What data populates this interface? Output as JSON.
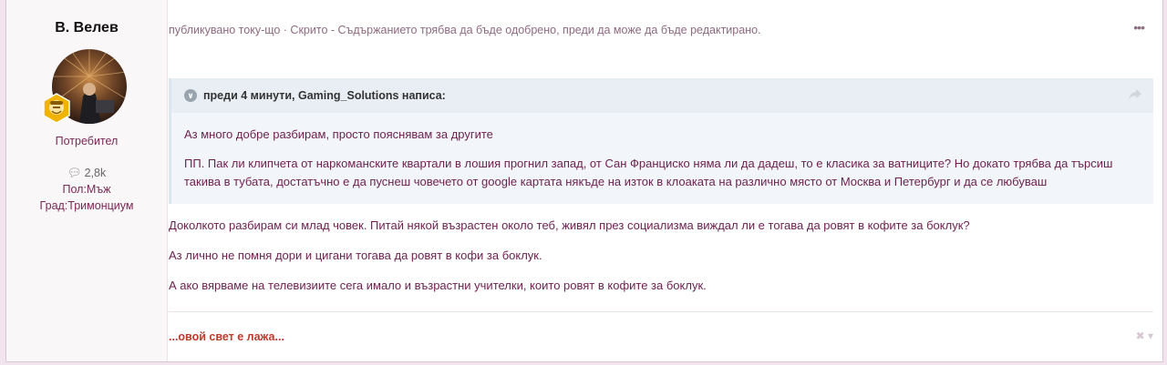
{
  "author": {
    "name": "В. Велев",
    "group": "Потребител",
    "posts": "2,8k",
    "fields": [
      "Пол:Мъж",
      "Град:Тримонциум"
    ]
  },
  "post": {
    "meta": "публикувано току-що · Скрито - Съдържанието трябва да бъде одобрено, преди да може да бъде редактирано.",
    "more_icon": "•••",
    "quote": {
      "header": "преди 4 минути, Gaming_Solutions написа:",
      "paragraphs": [
        "Аз много добре разбирам, просто пояснявам за другите",
        "ПП. Пак ли клипчета от наркоманските квартали в лошия прогнил запад, от Сан Франциско няма ли да дадеш, то е класика за ватниците? Но докато трябва да търсиш такива в тубата, достатъчно е да пуснеш човечето от google картата някъде на изток в клоаката на различно място от Москва и Петербург и да се любуваш"
      ]
    },
    "paragraphs": [
      "Доколкото разбирам си млад човек. Питай някой възрастен около теб, живял през социализма виждал ли е тогава да ровят в кофите за боклук?",
      "Аз лично не помня дори и цигани тогава да ровят в кофи за боклук.",
      "А ако вярваме на телевизиите сега имало и възрастни учителки, които ровят в кофите за боклук."
    ],
    "signature": "...овой свет е лажа...",
    "signature_controls": "✖ ▾"
  },
  "colors": {
    "background": "#f1e4ee",
    "text_accent": "#6d1f4e",
    "signature": "#c0392b"
  }
}
